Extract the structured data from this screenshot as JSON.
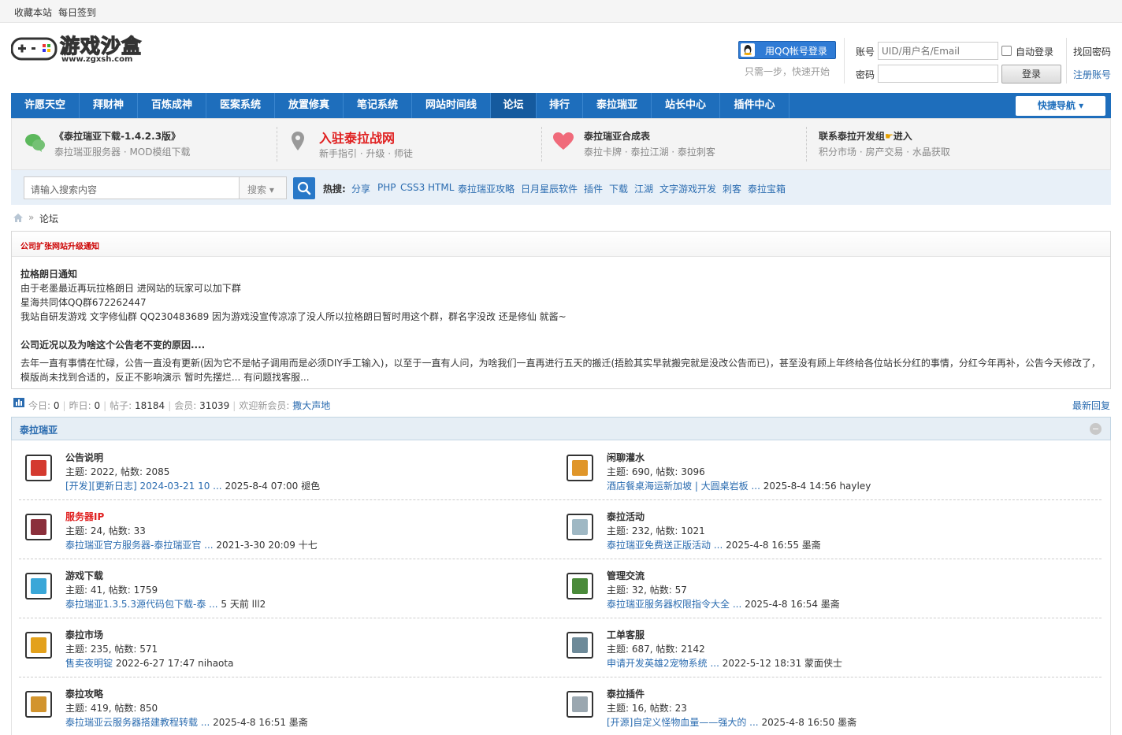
{
  "topbar": {
    "bookmark": "收藏本站",
    "checkin": "每日签到"
  },
  "header": {
    "logo_text": "游戏沙盒",
    "logo_url_text": "www.zgxsh.com",
    "qq_login": "用QQ帐号登录",
    "qq_hint": "只需一步，快速开始",
    "account_label": "账号",
    "account_placeholder": "UID/用户名/Email",
    "password_label": "密码",
    "autologin": "自动登录",
    "login_button": "登录",
    "forgot_password": "找回密码",
    "register": "注册账号"
  },
  "nav": {
    "items": [
      "许愿天空",
      "拜财神",
      "百炼成神",
      "医案系统",
      "放置修真",
      "笔记系统",
      "网站时间线",
      "论坛",
      "排行",
      "泰拉瑞亚",
      "站长中心",
      "插件中心"
    ],
    "active": "论坛",
    "quicknav": "快捷导航"
  },
  "info": [
    {
      "title": "《泰拉瑞亚下载-1.4.2.3版》",
      "sub": "泰拉瑞亚服务器 · MOD模组下载",
      "icon": "chat-icon"
    },
    {
      "title": "入驻泰拉战网",
      "sub": "新手指引 · 升级 · 师徒",
      "icon": "location-pin-icon"
    },
    {
      "title": "泰拉瑞亚合成表",
      "sub": "泰拉卡牌 · 泰拉江湖 · 泰拉刺客",
      "icon": "heart-icon"
    },
    {
      "title": "联系泰拉开发组",
      "title_suffix": "进入",
      "sub": "积分市场 · 房产交易 · 水晶获取",
      "icon": "hand-icon"
    }
  ],
  "search": {
    "placeholder": "请输入搜索内容",
    "select": "搜索",
    "hot_label": "热搜:",
    "hot": [
      "分享",
      "PHP",
      "CSS3",
      "HTML",
      "泰拉瑞亚攻略",
      "日月星辰软件",
      "插件",
      "下载",
      "江湖",
      "文字游戏开发",
      "刺客",
      "泰拉宝箱"
    ]
  },
  "breadcrumb": {
    "current": "论坛"
  },
  "notice": {
    "title": "公司扩张网站升级通知",
    "lines": [
      {
        "text": "拉格朗日通知",
        "bold": true
      },
      {
        "text": "由于老墨最近再玩拉格朗日 进网站的玩家可以加下群",
        "bold": false
      },
      {
        "text": "星海共同体QQ群672262447",
        "bold": false
      },
      {
        "text": "我站自研发游戏 文字修仙群 QQ230483689 因为游戏没宣传凉凉了没人所以拉格朗日暂时用这个群，群名字没改 还是修仙 就酱~",
        "bold": false
      },
      {
        "text": "公司近况以及为啥这个公告老不变的原因....",
        "bold": true
      },
      {
        "text": "去年一直有事情在忙碌，公告一直没有更新(因为它不是帖子调用而是必须DIY手工输入)，以至于一直有人问，为啥我们一直再进行五天的搬迁(捂脸其实早就搬完就是没改公告而已)，甚至没有顾上年终给各位站长分红的事情，分红今年再补，公告今天修改了，",
        "bold": false
      },
      {
        "text": "模版尚未找到合适的，反正不影响演示 暂时先摆烂... 有问题找客服...",
        "bold": false
      }
    ]
  },
  "stats": {
    "today_label": "今日:",
    "today": "0",
    "yesterday_label": "昨日:",
    "yesterday": "0",
    "posts_label": "帖子:",
    "posts": "18184",
    "members_label": "会员:",
    "members": "31039",
    "welcome_label": "欢迎新会员:",
    "new_member": "撒大声地",
    "latest_reply": "最新回复"
  },
  "category": {
    "title": "泰拉瑞亚",
    "forums": [
      {
        "name": "公告说明",
        "stats": "主题: 2022, 帖数: 2085",
        "last_link": "[开发][更新日志] 2024-03-21 10 ...",
        "last_meta": "2025-8-4 07:00 褪色",
        "red": false,
        "icon": "speech-bubble-icon",
        "color": "#d43a2f"
      },
      {
        "name": "闲聊灌水",
        "stats": "主题: 690, 帖数: 3096",
        "last_link": "酒店餐桌海运新加坡 | 大圆桌岩板 ...",
        "last_meta": "2025-8-4 14:56 hayley",
        "red": false,
        "icon": "beer-mug-icon",
        "color": "#e0962a"
      },
      {
        "name": "服务器IP",
        "stats": "主题: 24, 帖数: 33",
        "last_link": "泰拉瑞亚官方服务器-泰拉瑞亚官 ...",
        "last_meta": "2021-3-30 20:09 十七",
        "red": true,
        "icon": "brick-wall-icon",
        "color": "#8b2f3b"
      },
      {
        "name": "泰拉活动",
        "stats": "主题: 232, 帖数: 1021",
        "last_link": "泰拉瑞亚免费送正版活动 ...",
        "last_meta": "2025-4-8 16:55 墨斋",
        "red": false,
        "icon": "skull-icon",
        "color": "#9fb8c4"
      },
      {
        "name": "游戏下载",
        "stats": "主题: 41, 帖数: 1759",
        "last_link": "泰拉瑞亚1.3.5.3源代码包下载-泰 ...",
        "last_meta": "5 天前 lll2",
        "red": false,
        "icon": "arrows-icon",
        "color": "#3aa7d8"
      },
      {
        "name": "管理交流",
        "stats": "主题: 32, 帖数: 57",
        "last_link": "泰拉瑞亚服务器权限指令大全 ...",
        "last_meta": "2025-4-8 16:54 墨斋",
        "red": false,
        "icon": "goblin-icon",
        "color": "#4a8a3a"
      },
      {
        "name": "泰拉市场",
        "stats": "主题: 235, 帖数: 571",
        "last_link": "售卖夜明锭",
        "last_meta": "2022-6-27 17:47 nihaota",
        "red": false,
        "icon": "coin-icon",
        "color": "#e3a11c"
      },
      {
        "name": "工单客服",
        "stats": "主题: 687, 帖数: 2142",
        "last_link": "申请开发英雄2宠物系统 ...",
        "last_meta": "2022-5-12 18:31 蒙面侠士",
        "red": false,
        "icon": "robot-icon",
        "color": "#6d8a99"
      },
      {
        "name": "泰拉攻略",
        "stats": "主题: 419, 帖数: 850",
        "last_link": "泰拉瑞亚云服务器搭建教程转载 ...",
        "last_meta": "2025-4-8 16:51 墨斋",
        "red": false,
        "icon": "pickaxe-icon",
        "color": "#d2942e"
      },
      {
        "name": "泰拉插件",
        "stats": "主题: 16, 帖数: 23",
        "last_link": "[开源]自定义怪物血量——强大的 ...",
        "last_meta": "2025-4-8 16:50 墨斋",
        "red": false,
        "icon": "gear-block-icon",
        "color": "#9aa7b0"
      }
    ]
  }
}
